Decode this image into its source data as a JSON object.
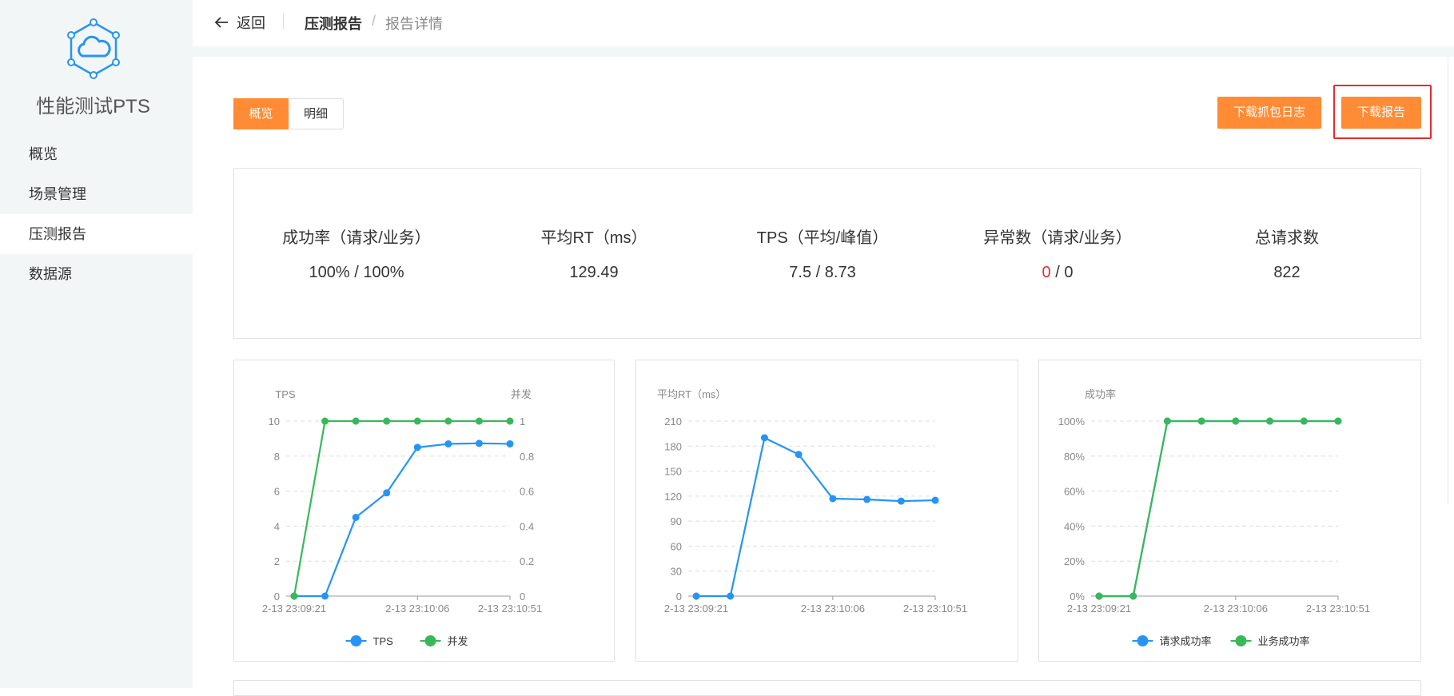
{
  "app": {
    "name": "性能测试PTS"
  },
  "sidebar": {
    "items": [
      {
        "label": "概览"
      },
      {
        "label": "场景管理"
      },
      {
        "label": "压测报告"
      },
      {
        "label": "数据源"
      }
    ]
  },
  "header": {
    "back_label": "返回",
    "breadcrumb": [
      "压测报告",
      "报告详情"
    ]
  },
  "view_tabs": [
    {
      "label": "概览"
    },
    {
      "label": "明细"
    }
  ],
  "actions": {
    "download_capture_log": "下载抓包日志",
    "download_report": "下载报告"
  },
  "stats": [
    {
      "label": "成功率（请求/业务）",
      "value": "100% / 100%"
    },
    {
      "label": "平均RT（ms）",
      "value": "129.49"
    },
    {
      "label": "TPS（平均/峰值）",
      "value": "7.5 / 8.73"
    },
    {
      "label": "异常数（请求/业务）",
      "value_error": "0",
      "value_sep": " / ",
      "value_rest": "0"
    },
    {
      "label": "总请求数",
      "value": "822"
    }
  ],
  "colors": {
    "accent": "#ff8b35",
    "blue_series": "#2694f5",
    "green_series": "#39b85a",
    "error": "#e52b2b"
  },
  "chart_data": [
    {
      "type": "line",
      "x": [
        "2-13 23:09:21",
        "",
        "",
        "",
        "2-13 23:10:06",
        "",
        "",
        "2-13 23:10:51"
      ],
      "xticks": [
        "2-13 23:09:21",
        "2-13 23:10:06",
        "2-13 23:10:51"
      ],
      "ylabel": "TPS",
      "y2label": "并发",
      "ylim": [
        0,
        10
      ],
      "yticks": [
        "0",
        "2",
        "4",
        "6",
        "8",
        "10"
      ],
      "y2lim": [
        0,
        1
      ],
      "y2ticks": [
        "0",
        "0.2",
        "0.4",
        "0.6",
        "0.8",
        "1"
      ],
      "series": [
        {
          "name": "TPS",
          "axis": "left",
          "color": "#2694f5",
          "values": [
            0,
            0,
            4.5,
            5.9,
            8.5,
            8.7,
            8.73,
            8.7
          ]
        },
        {
          "name": "并发",
          "axis": "right",
          "color": "#39b85a",
          "values": [
            0,
            1,
            1,
            1,
            1,
            1,
            1,
            1
          ]
        }
      ],
      "grid": true,
      "legend": "bottom"
    },
    {
      "type": "line",
      "x": [
        "2-13 23:09:21",
        "",
        "",
        "",
        "2-13 23:10:06",
        "",
        "",
        "2-13 23:10:51"
      ],
      "xticks": [
        "2-13 23:09:21",
        "2-13 23:10:06",
        "2-13 23:10:51"
      ],
      "ylabel": "平均RT（ms）",
      "ylim": [
        0,
        210
      ],
      "yticks": [
        "0",
        "30",
        "60",
        "90",
        "120",
        "150",
        "180",
        "210"
      ],
      "series": [
        {
          "name": "平均RT",
          "axis": "left",
          "color": "#2694f5",
          "values": [
            0,
            0,
            190,
            170,
            117,
            116,
            114,
            115
          ]
        }
      ],
      "grid": true,
      "legend": "none"
    },
    {
      "type": "line",
      "x": [
        "2-13 23:09:21",
        "",
        "",
        "",
        "2-13 23:10:06",
        "",
        "",
        "2-13 23:10:51"
      ],
      "xticks": [
        "2-13 23:09:21",
        "2-13 23:10:06",
        "2-13 23:10:51"
      ],
      "ylabel": "成功率",
      "ylim": [
        0,
        100
      ],
      "yticks": [
        "0%",
        "20%",
        "40%",
        "60%",
        "80%",
        "100%"
      ],
      "series": [
        {
          "name": "请求成功率",
          "axis": "left",
          "color": "#2694f5",
          "values": [
            0,
            0,
            100,
            100,
            100,
            100,
            100,
            100
          ]
        },
        {
          "name": "业务成功率",
          "axis": "left",
          "color": "#39b85a",
          "values": [
            0,
            0,
            100,
            100,
            100,
            100,
            100,
            100
          ]
        }
      ],
      "grid": true,
      "legend": "bottom"
    }
  ]
}
